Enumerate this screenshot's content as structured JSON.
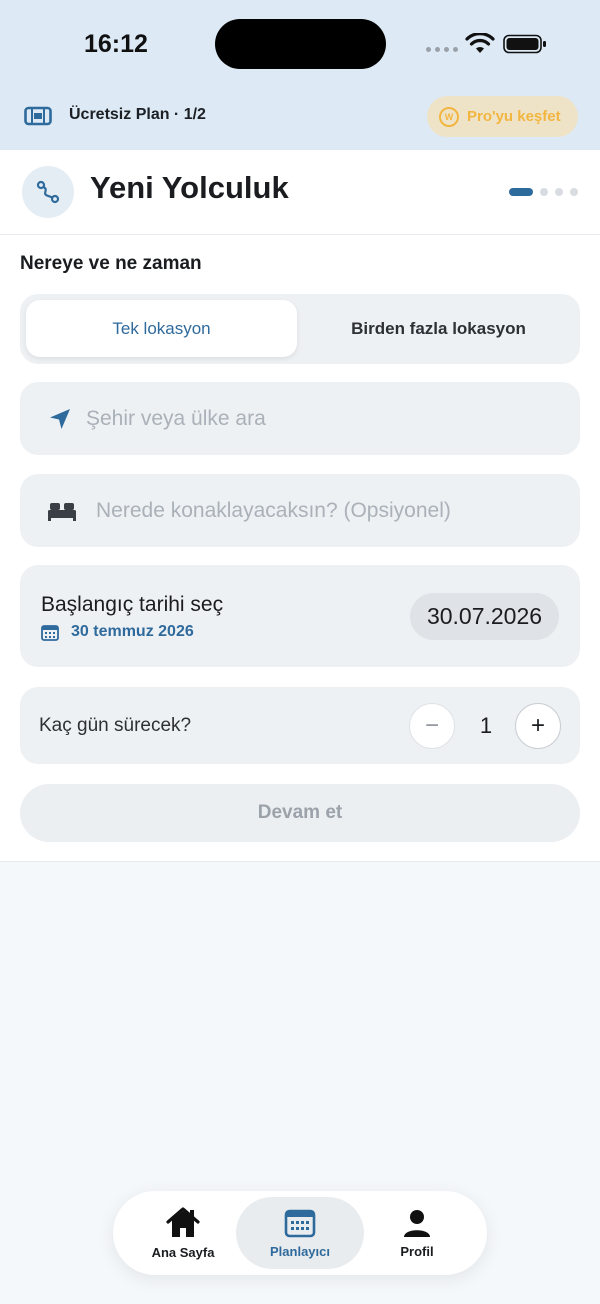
{
  "status_bar": {
    "time": "16:12"
  },
  "plan_bar": {
    "plan_label": "Ücretsiz Plan · 1/2",
    "pro_button_label": "Pro'yu keşfet",
    "pro_coin_letter": "W"
  },
  "header": {
    "title": "Yeni Yolculuk",
    "step_current": 1,
    "step_total": 4
  },
  "form": {
    "section_title": "Nereye ve ne zaman",
    "segment": {
      "options": [
        "Tek lokasyon",
        "Birden fazla lokasyon"
      ],
      "selected": "Tek lokasyon"
    },
    "city_search": {
      "placeholder": "Şehir veya ülke ara",
      "value": ""
    },
    "stay_field": {
      "placeholder": "Nerede konaklayacaksın? (Opsiyonel)",
      "value": ""
    },
    "start_date": {
      "title": "Başlangıç tarihi seç",
      "long_date": "30 temmuz 2026",
      "short_date": "30.07.2026"
    },
    "duration": {
      "label": "Kaç gün sürecek?",
      "value": "1",
      "minus": "−",
      "plus": "+"
    },
    "continue_label": "Devam et"
  },
  "tabbar": {
    "tabs": [
      {
        "label": "Ana Sayfa",
        "icon": "home-icon"
      },
      {
        "label": "Planlayıcı",
        "icon": "calendar-icon",
        "active": true
      },
      {
        "label": "Profil",
        "icon": "person-icon"
      }
    ]
  },
  "colors": {
    "accent": "#2f6a9c",
    "top_background": "#dde9f4",
    "pro_gold": "#f2b640"
  }
}
